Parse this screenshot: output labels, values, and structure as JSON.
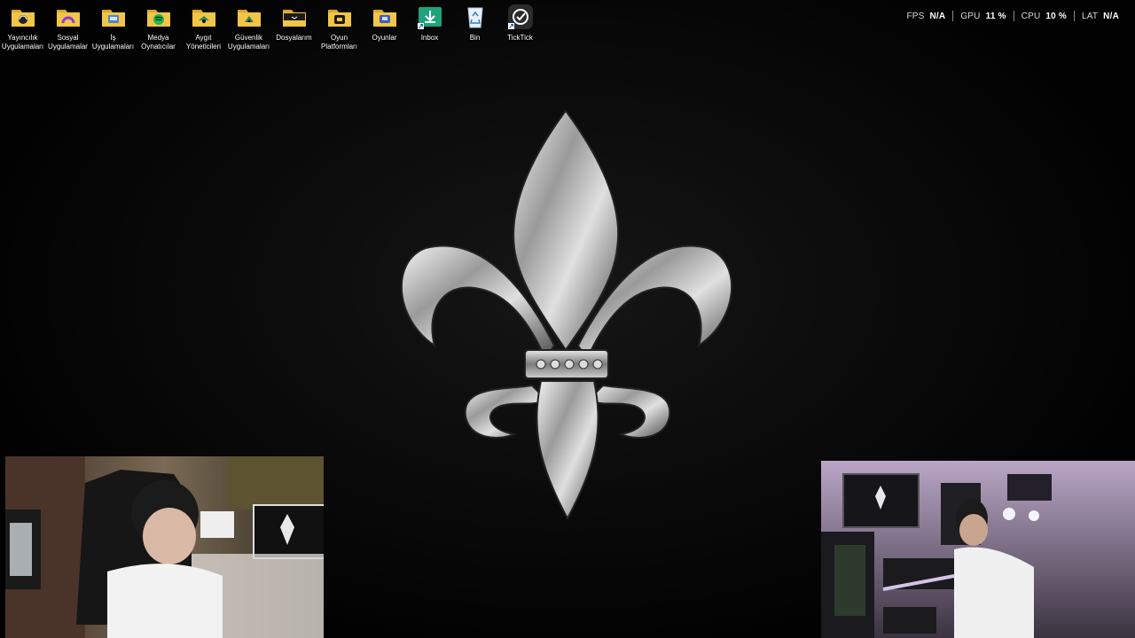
{
  "desktop_icons": [
    {
      "label": "Yayıncılık\nUygulamaları",
      "icon": "folder-streaming-icon"
    },
    {
      "label": "Sosyal\nUygulamalar",
      "icon": "folder-social-icon"
    },
    {
      "label": "İş\nUygulamaları",
      "icon": "folder-work-icon"
    },
    {
      "label": "Medya\nOynatıcılar",
      "icon": "folder-media-icon"
    },
    {
      "label": "Aygıt\nYöneticileri",
      "icon": "folder-device-icon"
    },
    {
      "label": "Güvenlik\nUygulamaları",
      "icon": "folder-security-icon"
    },
    {
      "label": "Dosyalarım",
      "icon": "folder-files-icon"
    },
    {
      "label": "Oyun\nPlatformları",
      "icon": "folder-gaming-platforms-icon"
    },
    {
      "label": "Oyunlar",
      "icon": "folder-games-icon"
    },
    {
      "label": "Inbox",
      "icon": "inbox-download-icon"
    },
    {
      "label": "Bin",
      "icon": "recycle-bin-icon"
    },
    {
      "label": "TickTick",
      "icon": "ticktick-icon"
    }
  ],
  "perf_overlay": {
    "fps": {
      "label": "FPS",
      "value": "N/A"
    },
    "gpu": {
      "label": "GPU",
      "value": "11 %"
    },
    "cpu": {
      "label": "CPU",
      "value": "10 %"
    },
    "lat": {
      "label": "LAT",
      "value": "N/A"
    }
  },
  "colors": {
    "folder_yellow": "#f2c548",
    "folder_dark": "#d9a72c",
    "inbox_green": "#1fa37a",
    "ticktick_bg": "#2b2b2b"
  }
}
